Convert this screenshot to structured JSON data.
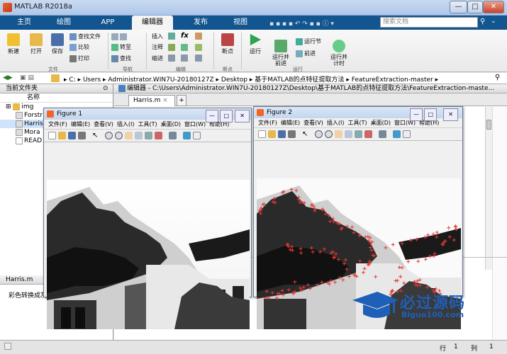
{
  "window": {
    "title": "MATLAB R2018a",
    "controls": [
      "—",
      "□",
      "✕"
    ]
  },
  "tabs": [
    {
      "label": "主页"
    },
    {
      "label": "绘图"
    },
    {
      "label": "APP"
    },
    {
      "label": "编辑器"
    },
    {
      "label": "发布"
    },
    {
      "label": "视图"
    }
  ],
  "search": {
    "placeholder": "搜索文档"
  },
  "ribbon": {
    "file": {
      "new": "新建",
      "open": "打开",
      "save": "保存",
      "find_files": "查找文件",
      "compare": "比较",
      "print": "打印",
      "group": "文件"
    },
    "nav": {
      "goto": "转至",
      "find": "查找",
      "group": "导航"
    },
    "edit": {
      "insert": "插入",
      "comment": "注释",
      "indent": "缩进",
      "fx": "fx",
      "group": "编辑"
    },
    "breakpoints": {
      "label": "断点",
      "group": "断点"
    },
    "run": {
      "run": "运行",
      "run_advance": "运行并\n前进",
      "run_section": "运行节",
      "advance": "前进",
      "run_time": "运行并\n计时",
      "group": "运行"
    }
  },
  "address": {
    "path": [
      "C:",
      "Users",
      "Administrator.WIN7U-20180127Z",
      "Desktop",
      "基于MATLAB的点特征提取方法",
      "FeatureExtraction-master"
    ]
  },
  "current_folder": {
    "title": "当前文件夹",
    "column": "名称",
    "items": [
      {
        "name": "img"
      },
      {
        "name": "Forstr"
      },
      {
        "name": "Harris"
      },
      {
        "name": "Mora"
      },
      {
        "name": "READ"
      }
    ]
  },
  "details": {
    "title": "Harris.m",
    "text": "彩色转换成灰"
  },
  "editor": {
    "title": "编辑器 - C:\\Users\\Administrator.WIN7U-20180127Z\\Desktop\\基于MATLAB的点特征提取方法\\FeatureExtraction-maste...",
    "tab": "Harris.m",
    "add": "+"
  },
  "status": {
    "row_label": "行",
    "row": "1",
    "col_label": "列",
    "col": "1"
  },
  "figure1": {
    "title": "Figure 1",
    "menu": [
      "文件(F)",
      "编辑(E)",
      "查看(V)",
      "插入(I)",
      "工具(T)",
      "桌面(D)",
      "窗口(W)",
      "帮助(H)"
    ]
  },
  "figure2": {
    "title": "Figure 2",
    "menu": [
      "文件(F)",
      "编辑(E)",
      "查看(V)",
      "插入(I)",
      "工具(T)",
      "桌面(D)",
      "窗口(W)",
      "帮助(H)"
    ]
  },
  "watermark": {
    "name": "必过源码",
    "url": "Biguo100.com"
  },
  "colors": {
    "tabbar": "#13558f",
    "accent": "#f26522",
    "corner": "#e53935",
    "watermark": "#1e5fb8"
  }
}
